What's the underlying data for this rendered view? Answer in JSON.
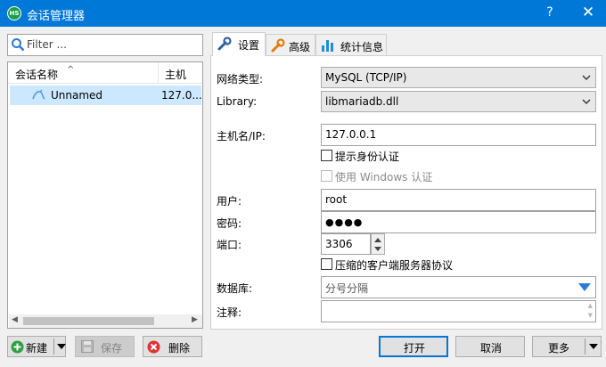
{
  "window": {
    "title": "会话管理器",
    "app_icon_text": "HS",
    "help": "?",
    "close": "✕"
  },
  "sidebar": {
    "filter_placeholder": "Filter ...",
    "col_name": "会话名称",
    "col_host": "主机",
    "sessions": [
      {
        "name": "Unnamed",
        "host": "127.0..."
      }
    ]
  },
  "tabs": [
    {
      "label": "设置",
      "icon": "wrench-icon"
    },
    {
      "label": "高级",
      "icon": "wrench-icon"
    },
    {
      "label": "统计信息",
      "icon": "bar-chart-icon"
    }
  ],
  "settings": {
    "network_type_label": "网络类型:",
    "network_type_value": "MySQL (TCP/IP)",
    "library_label": "Library:",
    "library_value": "libmariadb.dll",
    "host_label": "主机名/IP:",
    "host_value": "127.0.0.1",
    "prompt_auth_label": "提示身份认证",
    "windows_auth_label": "使用 Windows 认证",
    "user_label": "用户:",
    "user_value": "root",
    "password_label": "密码:",
    "password_value": "●●●●",
    "port_label": "端口:",
    "port_value": "3306",
    "compress_label": "压缩的客户端服务器协议",
    "database_label": "数据库:",
    "database_value": "分号分隔",
    "comment_label": "注释:",
    "comment_value": ""
  },
  "buttons": {
    "new": "新建",
    "save": "保存",
    "delete": "删除",
    "open": "打开",
    "cancel": "取消",
    "more": "更多"
  },
  "colors": {
    "titlebar": "#0078d7",
    "accent": "#0078d7",
    "selection": "#cce8ff"
  }
}
